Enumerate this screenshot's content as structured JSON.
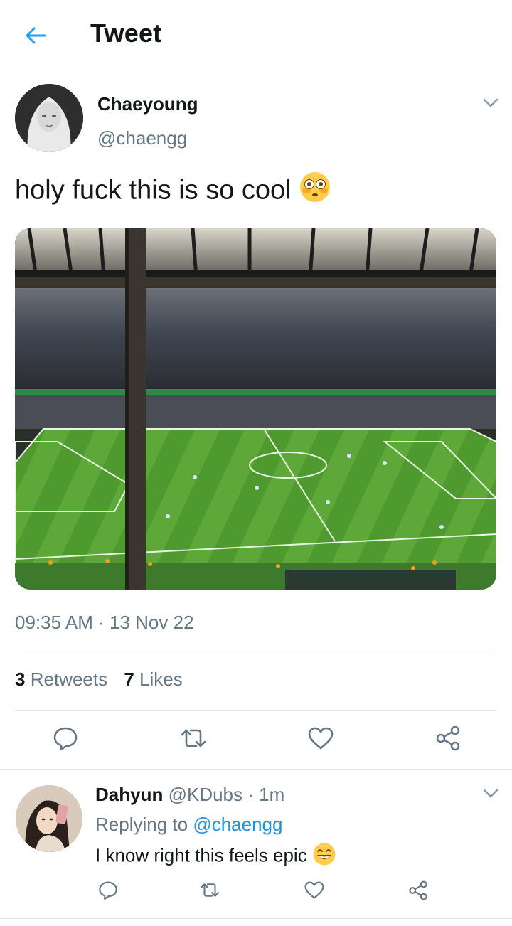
{
  "header": {
    "title": "Tweet",
    "back_icon": "arrow-left-icon",
    "accent": "#1da1f2"
  },
  "tweet": {
    "author_name": "Chaeyoung",
    "author_handle": "@chaengg",
    "text": "holy fuck this is so cool",
    "emoji": "flushed-face-emoji",
    "time": "09:35 AM",
    "separator": "·",
    "date": "13 Nov 22",
    "retweets_count": "3",
    "retweets_label": "Retweets",
    "likes_count": "7",
    "likes_label": "Likes",
    "media": "stadium-football-pitch-photo"
  },
  "actions": [
    "reply-icon",
    "retweet-icon",
    "like-icon",
    "share-icon"
  ],
  "reply": {
    "author_name": "Dahyun",
    "author_handle": "@KDubs",
    "separator": "·",
    "time": "1m",
    "replying_prefix": "Replying to",
    "replying_handle": "@chaengg",
    "text": "I know right this feels epic",
    "emoji": "grinning-face-emoji"
  },
  "colors": {
    "text": "#14171a",
    "secondary": "#657786",
    "link": "#1b95e0",
    "divider": "#e1e8ed",
    "icon": "#657786"
  }
}
